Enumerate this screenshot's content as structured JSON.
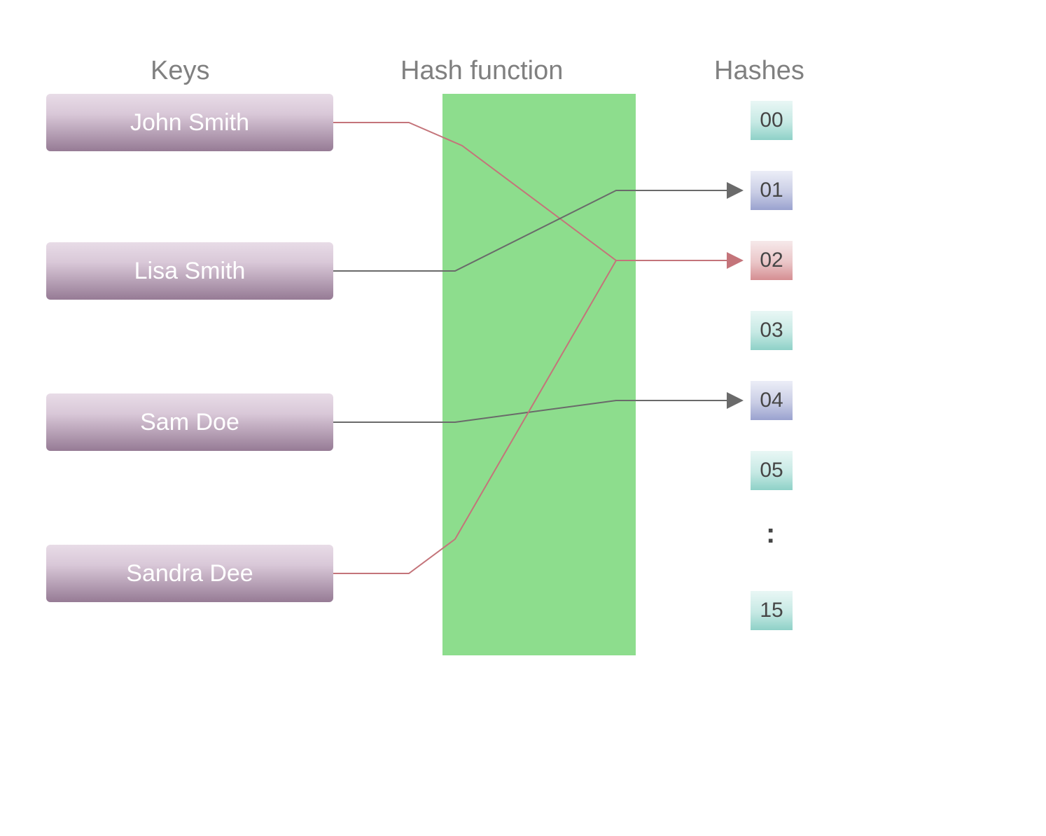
{
  "headers": {
    "keys": "Keys",
    "func": "Hash function",
    "hashes": "Hashes"
  },
  "keys": [
    {
      "name": "John Smith"
    },
    {
      "name": "Lisa Smith"
    },
    {
      "name": "Sam Doe"
    },
    {
      "name": "Sandra Dee"
    }
  ],
  "hashes": [
    {
      "v": "00",
      "color": "teal"
    },
    {
      "v": "01",
      "color": "purple"
    },
    {
      "v": "02",
      "color": "red"
    },
    {
      "v": "03",
      "color": "teal"
    },
    {
      "v": "04",
      "color": "purple"
    },
    {
      "v": "05",
      "color": "teal"
    }
  ],
  "lastHash": {
    "v": "15",
    "color": "teal"
  },
  "ellipsis": ":",
  "chart_data": {
    "type": "diagram",
    "title": "Hash function mapping",
    "keys": [
      "John Smith",
      "Lisa Smith",
      "Sam Doe",
      "Sandra Dee"
    ],
    "hash_slots": [
      "00",
      "01",
      "02",
      "03",
      "04",
      "05",
      "...",
      "15"
    ],
    "mappings": [
      {
        "key": "John Smith",
        "hash": "02",
        "collision": true
      },
      {
        "key": "Lisa Smith",
        "hash": "01",
        "collision": false
      },
      {
        "key": "Sam Doe",
        "hash": "04",
        "collision": false
      },
      {
        "key": "Sandra Dee",
        "hash": "02",
        "collision": true
      }
    ],
    "colors": {
      "key_box": "#967b95",
      "function_box": "#8ddd8d",
      "hash_default": "#8ed1c7",
      "hash_hit": "#9aa2cf",
      "hash_collision": "#d58e92",
      "line_normal": "#6a6a6a",
      "line_collision": "#c4747a"
    }
  }
}
